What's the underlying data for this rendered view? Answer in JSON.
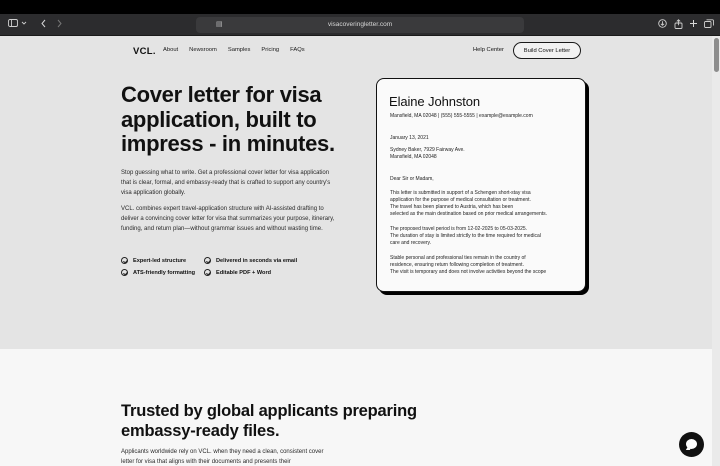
{
  "browser": {
    "url": "visacoveringletter.com",
    "icons": [
      "sidebar-icon",
      "chevron-down-icon",
      "back-icon",
      "forward-icon",
      "page-icon",
      "download-icon",
      "share-icon",
      "new-tab-icon",
      "tabs-overview-icon"
    ]
  },
  "nav": {
    "logo": "VCL.",
    "links": [
      "About",
      "Newsroom",
      "Samples",
      "Pricing",
      "FAQs"
    ],
    "help": "Help Center",
    "cta": "Build Cover Letter"
  },
  "hero": {
    "title": "Cover letter for visa application, built to impress - in minutes.",
    "p1": "Stop guessing what to write. Get a professional cover letter for visa application that is clear, formal, and embassy-ready that is crafted to support any country's visa application globally.",
    "p2": "VCL. combines expert travel-application structure with AI-assisted drafting to deliver a convincing cover letter for visa that summarizes your purpose, itinerary, funding, and return plan—without grammar issues and without wasting time.",
    "features": [
      "Expert-led structure",
      "Delivered in seconds via email",
      "ATS-friendly formatting",
      "Editable PDF + Word"
    ]
  },
  "letter": {
    "name": "Elaine Johnston",
    "contact": "Mansfield, MA 02048 | (555) 555-5555 | example@example.com",
    "date": "January 13, 2021",
    "recipient1": "Sydney Baker, 7929 Fairway Ave.",
    "recipient2": "Mansfield, MA 02048",
    "salutation": "Dear Sir or Madam,",
    "para1_l1": "This letter is submitted in support of a Schengen short-stay visa",
    "para1_l2": "application for the purpose of medical consultation or treatment.",
    "para1_l3": "The travel has been planned to Austria, which has been",
    "para1_l4": "selected as the main destination based on prior medical arrangements.",
    "para2_l1": "The proposed travel period is from 12-02-2025  to 05-03-2025.",
    "para2_l2": "The duration of stay is limited strictly to the time required for medical",
    "para2_l3": "care and recovery.",
    "para3_l1": "Stable personal and professional ties remain in the country of",
    "para3_l2": "residence, ensuring return following completion of treatment.",
    "para3_l3": "The visit is temporary and does not involve activities beyond the scope"
  },
  "trusted": {
    "title": "Trusted by global applicants preparing embassy-ready files.",
    "p": "Applicants worldwide rely on VCL. when they need a clean, consistent cover letter for visa that aligns with their documents and presents their"
  },
  "chat": {
    "icon": "chat-icon"
  }
}
